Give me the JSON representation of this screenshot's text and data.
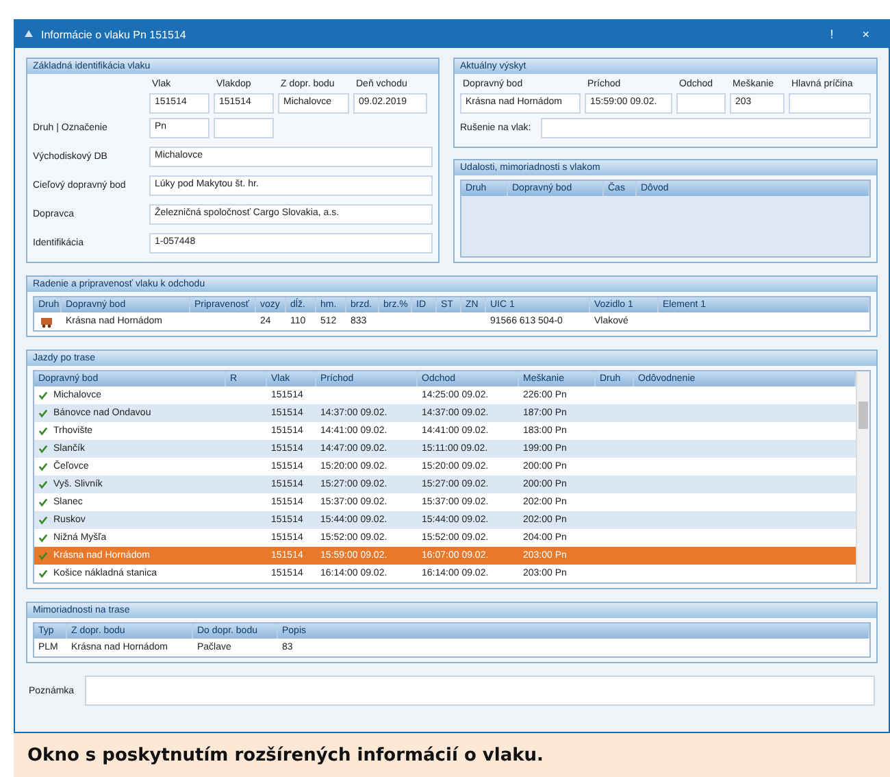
{
  "window": {
    "title": "Informácie o vlaku Pn 151514",
    "controls": [
      "!",
      "×"
    ]
  },
  "identification": {
    "title": "Základná identifikácia vlaku",
    "columns": [
      "Vlak",
      "Vlakdop",
      "Z dopr. bodu",
      "Deň vchodu"
    ],
    "values": [
      "151514",
      "151514",
      "Michalovce",
      "09.02.2019"
    ],
    "fields": [
      {
        "label": "Druh | Označenie",
        "value": "Pn"
      },
      {
        "label": "Východiskový DB",
        "value": "Michalovce"
      },
      {
        "label": "Cieľový dopravný bod",
        "value": "Lúky pod Makytou št. hr."
      },
      {
        "label": "Dopravca",
        "value": "Železničná spoločnosť Cargo Slovakia, a.s."
      },
      {
        "label": "Identifikácia",
        "value": "1-057448"
      }
    ]
  },
  "current": {
    "title": "Aktuálny výskyt",
    "columns": [
      "Dopravný bod",
      "Príchod",
      "Odchod",
      "Meškanie",
      "Hlavná príčina"
    ],
    "values": {
      "point": "Krásna nad Hornádom",
      "arrival": "15:59:00 09.02.",
      "delay": "203"
    },
    "note_label": "Rušenie na vlak:"
  },
  "events": {
    "title": "Udalosti, mimoriadnosti s vlakom",
    "columns": [
      "Druh",
      "Dopravný bod",
      "Čas",
      "Dôvod"
    ]
  },
  "composition": {
    "title": "Radenie a pripravenosť vlaku k odchodu",
    "columns": [
      "Druh",
      "Dopravný bod",
      "Pripravenosť",
      "vozy",
      "dĺž.",
      "hm.",
      "brzd.",
      "brz.%",
      "ID",
      "ST",
      "ZN",
      "UIC 1",
      "Vozidlo 1",
      "Element 1"
    ],
    "rows": [
      {
        "point": "Krásna nad Hornádom",
        "cars": "24",
        "length": "110",
        "weight": "512",
        "brake": "833",
        "uic": "91566 613 504-0",
        "vehicle": "Vlakové"
      }
    ]
  },
  "route": {
    "title": "Jazdy po trase",
    "columns": [
      "Dopravný bod",
      "R",
      "Vlak",
      "Príchod",
      "Odchod",
      "Meškanie",
      "Druh",
      "Odôvodnenie"
    ],
    "rows": [
      {
        "station": "Michalovce",
        "train": "151514",
        "departure": "14:25:00 09.02.",
        "delay": "226:00 Pn",
        "selected": false
      },
      {
        "station": "Bánovce nad Ondavou",
        "train": "151514",
        "arrival": "14:37:00 09.02.",
        "departure": "14:37:00 09.02.",
        "delay": "187:00 Pn",
        "selected": false
      },
      {
        "station": "Trhovište",
        "train": "151514",
        "arrival": "14:41:00 09.02.",
        "departure": "14:41:00 09.02.",
        "delay": "183:00 Pn",
        "selected": false
      },
      {
        "station": "Slančík",
        "train": "151514",
        "arrival": "14:47:00 09.02.",
        "departure": "15:11:00 09.02.",
        "delay": "199:00 Pn",
        "selected": false
      },
      {
        "station": "Čeľovce",
        "train": "151514",
        "arrival": "15:20:00 09.02.",
        "departure": "15:20:00 09.02.",
        "delay": "200:00 Pn",
        "selected": false
      },
      {
        "station": "Vyš. Slivník",
        "train": "151514",
        "arrival": "15:27:00 09.02.",
        "departure": "15:27:00 09.02.",
        "delay": "200:00 Pn",
        "selected": false
      },
      {
        "station": "Slanec",
        "train": "151514",
        "arrival": "15:37:00 09.02.",
        "departure": "15:37:00 09.02.",
        "delay": "202:00 Pn",
        "selected": false
      },
      {
        "station": "Ruskov",
        "train": "151514",
        "arrival": "15:44:00 09.02.",
        "departure": "15:44:00 09.02.",
        "delay": "202:00 Pn",
        "selected": false
      },
      {
        "station": "Nižná Myšľa",
        "train": "151514",
        "arrival": "15:52:00 09.02.",
        "departure": "15:52:00 09.02.",
        "delay": "204:00 Pn",
        "selected": false
      },
      {
        "station": "Krásna nad Hornádom",
        "train": "151514",
        "arrival": "15:59:00 09.02.",
        "departure": "16:07:00 09.02.",
        "delay": "203:00 Pn",
        "selected": true
      },
      {
        "station": "Košice nákladná stanica",
        "train": "151514",
        "arrival": "16:14:00 09.02.",
        "departure": "16:14:00 09.02.",
        "delay": "203:00 Pn",
        "selected": false
      }
    ]
  },
  "restrictions": {
    "title": "Mimoriadnosti na trase",
    "columns": [
      "Typ",
      "Z dopr. bodu",
      "Do dopr. bodu",
      "Popis"
    ],
    "rows": [
      {
        "type": "PLM",
        "from": "Krásna nad Hornádom",
        "to": "Pačlave",
        "description": "83"
      }
    ]
  },
  "note": {
    "label": "Poznámka"
  },
  "caption": "Okno s poskytnutím rozšírených informácií o vlaku."
}
